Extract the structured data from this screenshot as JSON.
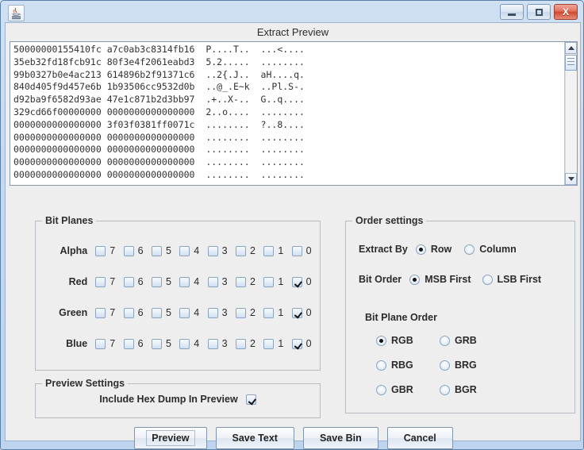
{
  "window": {
    "app_icon": "java-coffee-cup-icon",
    "controls": [
      {
        "name": "minimize",
        "glyph": "minimize-icon"
      },
      {
        "name": "maximize",
        "glyph": "maximize-icon"
      },
      {
        "name": "close",
        "glyph": "close-icon",
        "label": "X",
        "color": "#cf4a32"
      }
    ]
  },
  "dialog": {
    "title": "Extract Preview"
  },
  "hexdump": {
    "lines": [
      "50000000155410fc a7c0ab3c8314fb16  P....T..  ...<....",
      "35eb32fd18fcb91c 80f3e4f2061eabd3  5.2.....  ........",
      "99b0327b0e4ac213 614896b2f91371c6  ..2{.J..  aH....q.",
      "840d405f9d457e6b 1b93506cc9532d0b  ..@_.E~k  ..Pl.S-.",
      "d92ba9f6582d93ae 47e1c871b2d3bb97  .+..X-..  G..q....",
      "329cd66f00000000 0000000000000000  2..o....  ........",
      "0000000000000000 3f03f0381ff0071c  ........  ?..8....",
      "0000000000000000 0000000000000000  ........  ........",
      "0000000000000000 0000000000000000  ........  ........",
      "0000000000000000 0000000000000000  ........  ........",
      "0000000000000000 0000000000000000  ........  ........"
    ],
    "scrollbar": {
      "up_arrow": "triangle-up-icon",
      "down_arrow": "triangle-down-icon"
    }
  },
  "bit_planes": {
    "legend": "Bit Planes",
    "bits": [
      "7",
      "6",
      "5",
      "4",
      "3",
      "2",
      "1",
      "0"
    ],
    "rows": [
      {
        "label": "Alpha",
        "checked": [
          false,
          false,
          false,
          false,
          false,
          false,
          false,
          false
        ]
      },
      {
        "label": "Red",
        "checked": [
          false,
          false,
          false,
          false,
          false,
          false,
          false,
          true
        ]
      },
      {
        "label": "Green",
        "checked": [
          false,
          false,
          false,
          false,
          false,
          false,
          false,
          true
        ]
      },
      {
        "label": "Blue",
        "checked": [
          false,
          false,
          false,
          false,
          false,
          false,
          false,
          true
        ]
      }
    ]
  },
  "order_settings": {
    "legend": "Order settings",
    "extract_by": {
      "label": "Extract By",
      "options": [
        "Row",
        "Column"
      ],
      "selected": "Row"
    },
    "bit_order": {
      "label": "Bit Order",
      "options": [
        "MSB First",
        "LSB First"
      ],
      "selected": "MSB First"
    },
    "bit_plane_order": {
      "label": "Bit Plane Order",
      "options": [
        "RGB",
        "GRB",
        "RBG",
        "BRG",
        "GBR",
        "BGR"
      ],
      "selected": "RGB"
    }
  },
  "preview_settings": {
    "legend": "Preview Settings",
    "include_hex_dump": {
      "label": "Include Hex Dump In Preview",
      "checked": true
    }
  },
  "buttons": [
    {
      "label": "Preview",
      "focused": true
    },
    {
      "label": "Save Text",
      "focused": false
    },
    {
      "label": "Save Bin",
      "focused": false
    },
    {
      "label": "Cancel",
      "focused": false
    }
  ]
}
